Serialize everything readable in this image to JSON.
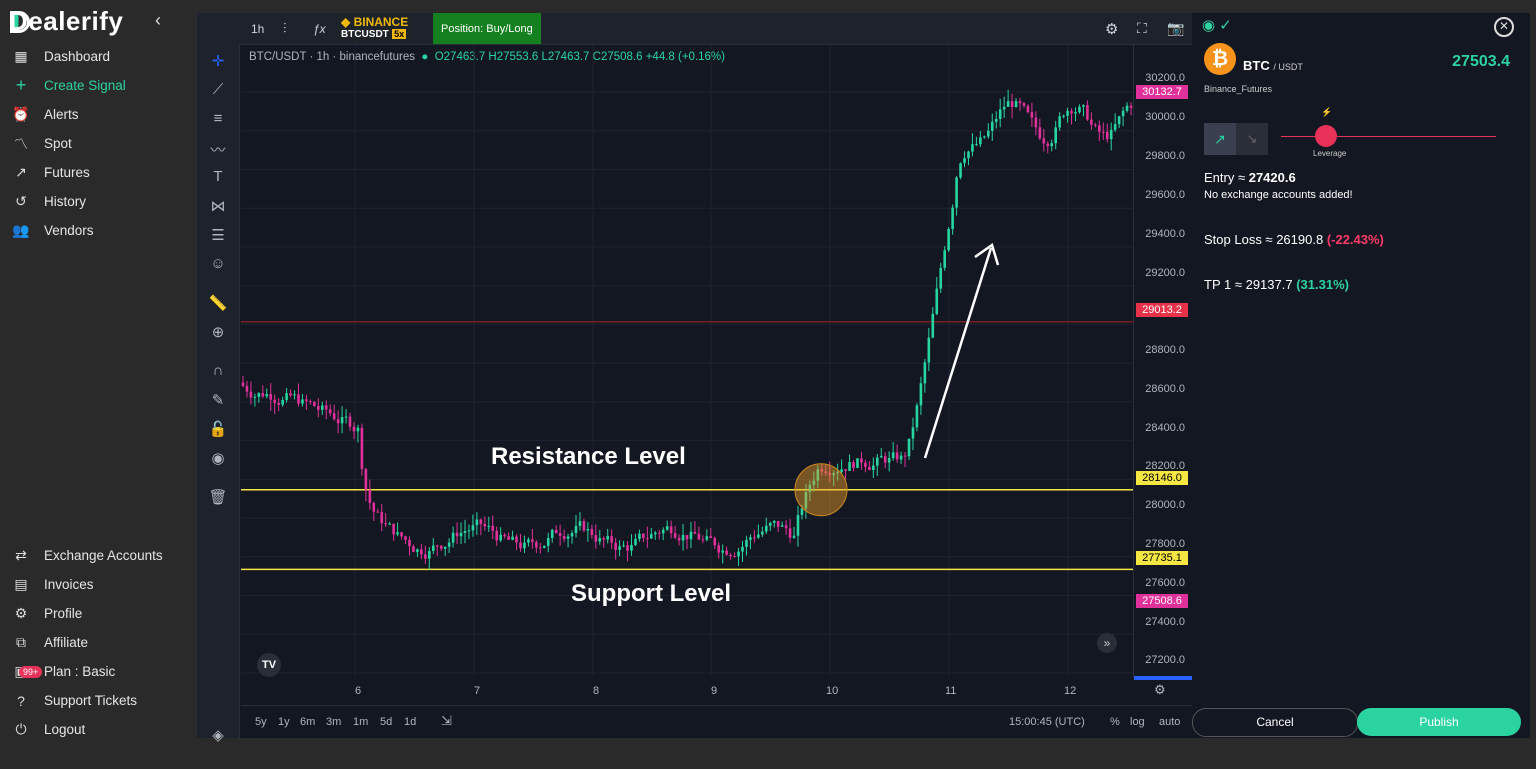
{
  "app": {
    "brand": "Dealerify"
  },
  "sidebar": {
    "top_items": [
      {
        "label": "Dashboard",
        "icon": "grid-icon"
      },
      {
        "label": "Create Signal",
        "icon": "plus-icon",
        "active": true
      },
      {
        "label": "Alerts",
        "icon": "alarm-icon"
      },
      {
        "label": "Spot",
        "icon": "trend-icon"
      },
      {
        "label": "Futures",
        "icon": "trend-icon"
      },
      {
        "label": "History",
        "icon": "history-icon"
      },
      {
        "label": "Vendors",
        "icon": "users-icon"
      }
    ],
    "bottom_items": [
      {
        "label": "Exchange Accounts",
        "icon": "exchange-icon"
      },
      {
        "label": "Invoices",
        "icon": "invoice-icon"
      },
      {
        "label": "Profile",
        "icon": "gear-icon"
      },
      {
        "label": "Affiliate",
        "icon": "affiliate-icon"
      },
      {
        "label": "Plan : Basic",
        "icon": "plan-icon",
        "badge": "99+"
      },
      {
        "label": "Support Tickets",
        "icon": "help-icon"
      },
      {
        "label": "Logout",
        "icon": "power-icon"
      }
    ]
  },
  "chart": {
    "interval": "1h",
    "exchange_badge": "BINANCE",
    "pair_badge": "BTCUSDT",
    "leverage_badge": "5x",
    "position": "Position: Buy/Long",
    "legend_symbol": "BTC/USDT · 1h · binancefutures",
    "ohlc": "O27463.7 H27553.6 L27463.7 C27508.6 +44.8 (+0.16%)",
    "annotation_resistance": "Resistance Level",
    "annotation_support": "Support Level",
    "price_tags": {
      "top": "30132.7",
      "red": "29013.2",
      "resistance": "28146.0",
      "support": "27735.1",
      "last": "27508.6"
    },
    "price_labels": [
      "30200.0",
      "30000.0",
      "29800.0",
      "29600.0",
      "29400.0",
      "29200.0",
      "28800.0",
      "28600.0",
      "28400.0",
      "28200.0",
      "28000.0",
      "27800.0",
      "27600.0",
      "27400.0",
      "27200.0"
    ],
    "time_labels": [
      "6",
      "7",
      "8",
      "9",
      "10",
      "11",
      "12"
    ],
    "ranges": [
      "5y",
      "1y",
      "6m",
      "3m",
      "1m",
      "5d",
      "1d"
    ],
    "clock": "15:00:45 (UTC)",
    "scale_opts": [
      "%",
      "log",
      "auto"
    ],
    "colors": {
      "up": "#26d5a0",
      "down": "#e0309a",
      "resistance": "#f5e642",
      "red_line": "#b22222"
    }
  },
  "panel": {
    "symbol": "BTC",
    "quote": "/ USDT",
    "price": "27503.4",
    "exchange": "Binance_Futures",
    "leverage_label": "Leverage",
    "entry_label": "Entry ≈",
    "entry_value": "27420.6",
    "no_accounts": "No exchange accounts added!",
    "stop_label": "Stop Loss ≈",
    "stop_value": "26190.8",
    "stop_pct": "(-22.43%)",
    "tp_label": "TP 1 ≈",
    "tp_value": "29137.7",
    "tp_pct": "(31.31%)",
    "cancel": "Cancel",
    "publish": "Publish"
  }
}
